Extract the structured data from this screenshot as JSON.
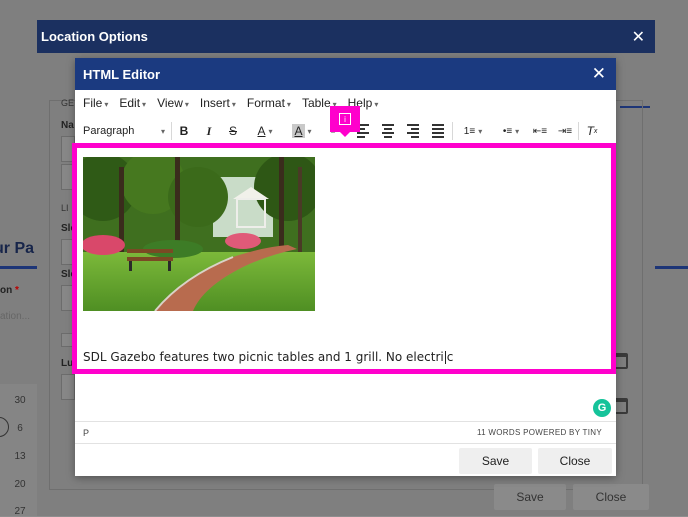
{
  "background": {
    "heading": "ur Pa",
    "field_label": "on",
    "field_required": "*",
    "field_placeholder": "ation...",
    "calendar_days": [
      "30",
      "6",
      "13",
      "20",
      "27"
    ]
  },
  "location_dialog": {
    "title": "Location Options",
    "close_icon": "close-icon",
    "section_labels": [
      "GE",
      "LI"
    ],
    "row_labels": [
      "Na",
      "Sle",
      "Sle",
      "Lu"
    ],
    "save_label": "Save",
    "close_label": "Close"
  },
  "editor": {
    "title": "HTML Editor",
    "close_icon": "close-icon",
    "menu": [
      "File",
      "Edit",
      "View",
      "Insert",
      "Format",
      "Table",
      "Help"
    ],
    "block_format": "Paragraph",
    "toolbar_icons": [
      "bold-icon",
      "italic-icon",
      "strikethrough-icon",
      "text-color-icon",
      "background-color-icon",
      "link-icon",
      "align-left-icon",
      "align-center-icon",
      "align-right-icon",
      "align-justify-icon",
      "numbered-list-icon",
      "bulleted-list-icon",
      "outdent-icon",
      "indent-icon",
      "clear-formatting-icon"
    ],
    "content_text_before_cursor": "SDL Gazebo features two picnic tables and 1 grill. No electri",
    "content_text_after_cursor": "c",
    "status_path": "P",
    "status_right": "11 WORDS POWERED BY TINY",
    "save_label": "Save",
    "close_label": "Close"
  },
  "highlight": {
    "color": "#ff00cc",
    "badge_icon": "info-icon"
  },
  "colors": {
    "header_blue": "#1b3a80",
    "grammarly_green": "#15c39a"
  }
}
